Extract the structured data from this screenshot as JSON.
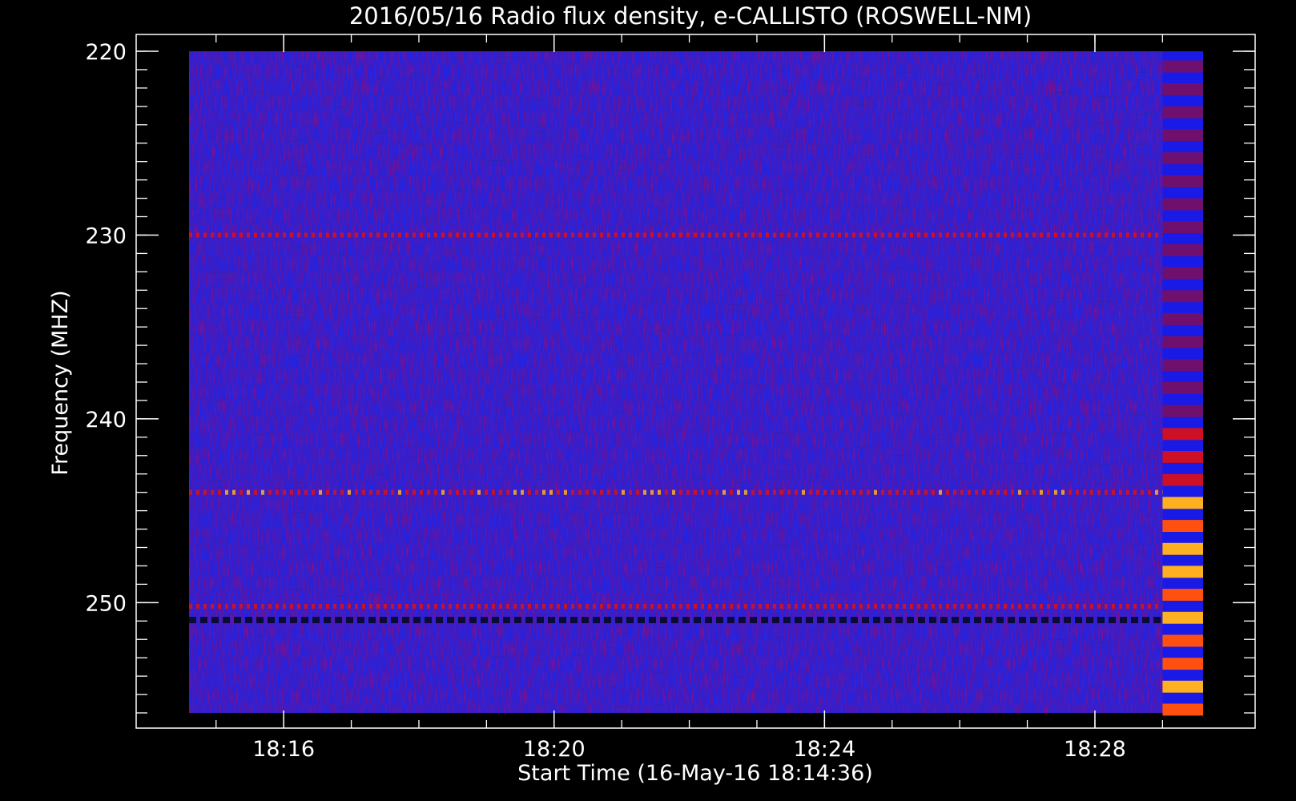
{
  "chart_data": {
    "type": "heatmap",
    "title": "2016/05/16  Radio flux density, e-CALLISTO (ROSWELL-NM)",
    "xlabel": "Start Time (16-May-16 18:14:36)",
    "ylabel": "Frequency (MHZ)",
    "x_unit": "time (HH:MM, 16-May-16)",
    "y_unit": "MHz",
    "xlim": [
      "18:14:36",
      "18:29:36"
    ],
    "ylim": [
      256,
      220
    ],
    "x_ticks": [
      "18:16",
      "18:20",
      "18:24",
      "18:28"
    ],
    "x_minor_tick_step_seconds": 60,
    "y_ticks": [
      220,
      230,
      240,
      250
    ],
    "y_minor_tick_step": 1,
    "colormap": [
      "#0a0a30",
      "#1a1ae6",
      "#7a1060",
      "#e01010",
      "#ff5010",
      "#ffb020",
      "#d8d820"
    ],
    "background_level_color": "#2323e0",
    "features": [
      {
        "kind": "horizontal band (RFI)",
        "frequency_mhz": 230.0,
        "start": "18:14:36",
        "end": "18:29:00",
        "intensity": "medium"
      },
      {
        "kind": "horizontal band (RFI)",
        "frequency_mhz": 244.0,
        "start": "18:14:36",
        "end": "18:29:00",
        "intensity": "high"
      },
      {
        "kind": "horizontal band (RFI)",
        "frequency_mhz": 250.2,
        "start": "18:14:36",
        "end": "18:29:00",
        "intensity": "medium"
      },
      {
        "kind": "horizontal band (RFI, dashed dark)",
        "frequency_mhz": 250.9,
        "start": "18:14:36",
        "end": "18:29:00",
        "intensity": "dark"
      },
      {
        "kind": "broadband emission",
        "frequency_range_mhz": [
          220.5,
          256
        ],
        "start": "18:29:00",
        "end": "18:29:36",
        "intensity": "high (strongest 244-256 MHz)"
      }
    ]
  },
  "colors": {
    "background": "#000000",
    "axes": "#ffffff",
    "text": "#ffffff"
  }
}
